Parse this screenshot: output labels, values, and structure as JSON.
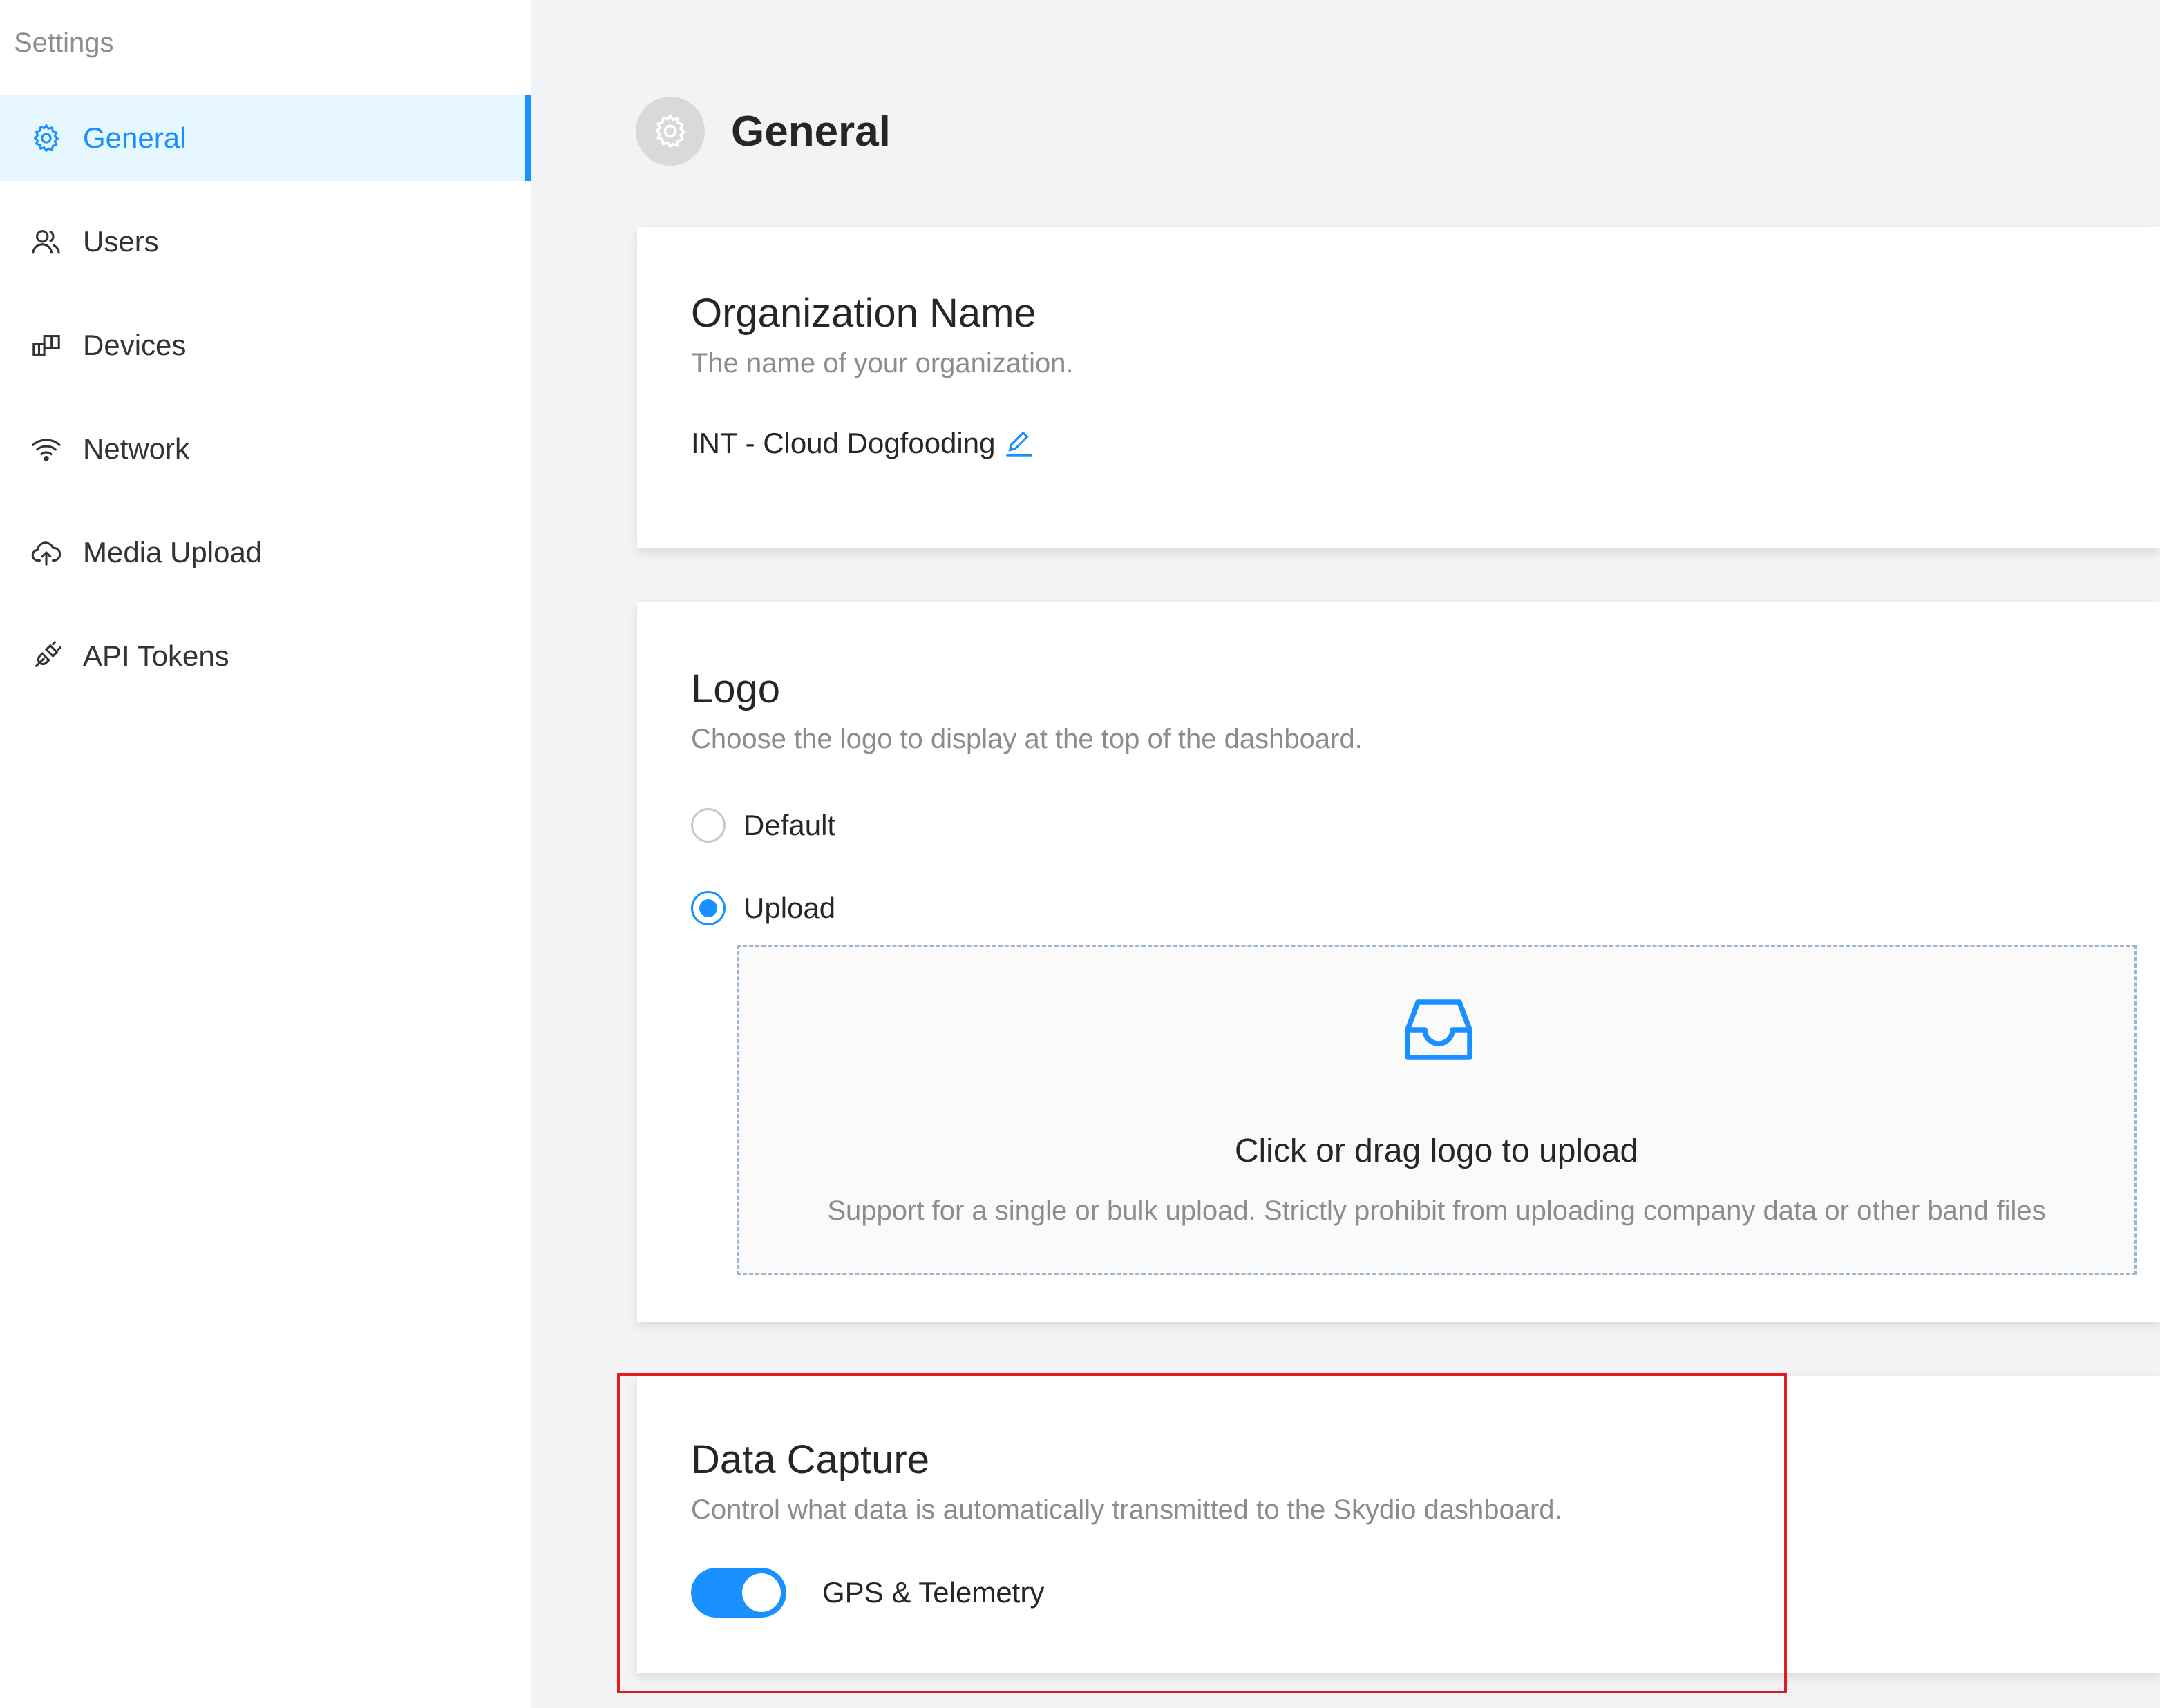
{
  "sidebar": {
    "title": "Settings",
    "items": [
      {
        "label": "General",
        "icon": "gear-icon",
        "active": true
      },
      {
        "label": "Users",
        "icon": "users-icon"
      },
      {
        "label": "Devices",
        "icon": "devices-icon"
      },
      {
        "label": "Network",
        "icon": "wifi-icon"
      },
      {
        "label": "Media Upload",
        "icon": "cloud-upload-icon"
      },
      {
        "label": "API Tokens",
        "icon": "api-icon"
      }
    ]
  },
  "header": {
    "title": "General",
    "icon": "gear-icon"
  },
  "org_card": {
    "title": "Organization Name",
    "description": "The name of your organization.",
    "value": "INT - Cloud Dogfooding"
  },
  "logo_card": {
    "title": "Logo",
    "description": "Choose the logo to display at the top of the dashboard.",
    "options": [
      {
        "label": "Default",
        "checked": false
      },
      {
        "label": "Upload",
        "checked": true
      }
    ],
    "upload": {
      "text": "Click or drag logo to upload",
      "hint": "Support for a single or bulk upload. Strictly prohibit from uploading company data or other band files"
    }
  },
  "data_capture_card": {
    "title": "Data Capture",
    "description": "Control what data is automatically transmitted to the Skydio dashboard.",
    "toggle_label": "GPS & Telemetry",
    "toggle_on": true
  },
  "colors": {
    "accent": "#1890ff",
    "highlight": "#e31b1b",
    "sidebar_active_bg": "#e6f7ff"
  }
}
